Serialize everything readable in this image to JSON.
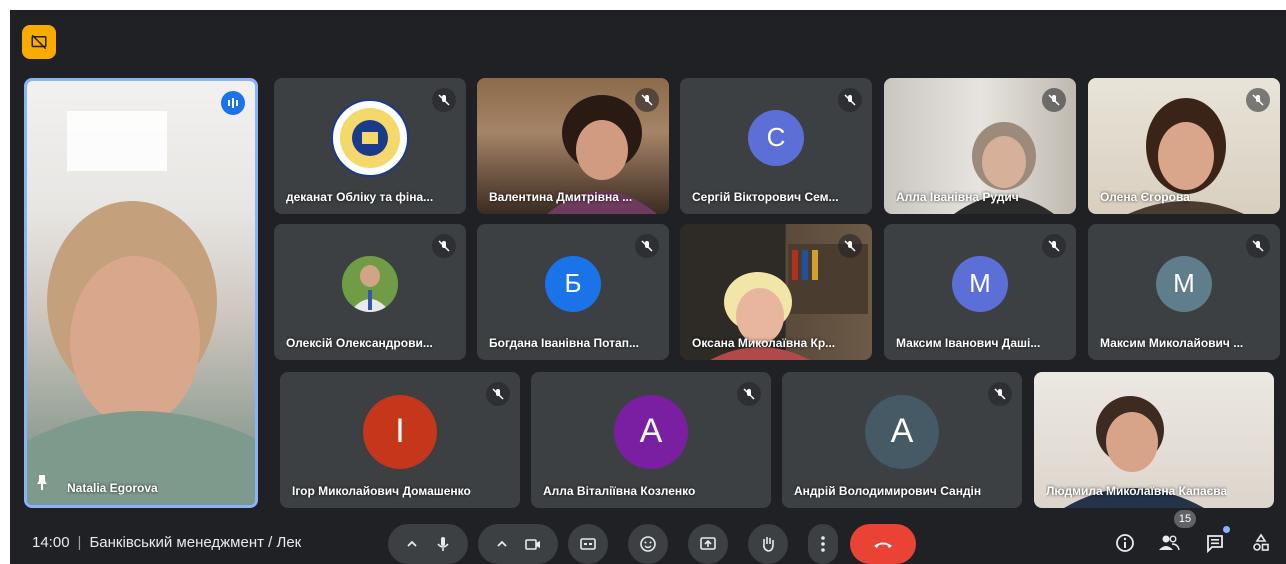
{
  "tiles_row1": [
    {
      "name": "деканат Обліку та фіна...",
      "avatar_type": "logo-seal",
      "video": "logo"
    },
    {
      "name": "Валентина Дмитрівна ...",
      "video": "camera-1"
    },
    {
      "name": "Сергій Вікторович Сем...",
      "initial": "С",
      "color": "#5b6fd6"
    },
    {
      "name": "Алла Іванівна Рудич",
      "video": "camera-2"
    },
    {
      "name": "Олена Єгорова",
      "video": "camera-3"
    }
  ],
  "tiles_row2": [
    {
      "name": "Олексій Олександрови...",
      "video": "photo"
    },
    {
      "name": "Богдана Іванівна Потап...",
      "initial": "Б",
      "color": "#1a73e8"
    },
    {
      "name": "Оксана Миколаївна Кр...",
      "video": "camera-4"
    },
    {
      "name": "Максим Іванович Даші...",
      "initial": "М",
      "color": "#5b6fd6"
    },
    {
      "name": "Максим Миколайович ...",
      "initial": "М",
      "color": "#607d8b"
    }
  ],
  "tiles_row3": [
    {
      "name": "Ігор Миколайович Домашенко",
      "initial": "І",
      "color": "#c5361b"
    },
    {
      "name": "Алла Віталіївна Козленко",
      "initial": "А",
      "color": "#7b1fa2"
    },
    {
      "name": "Андрій Володимирович Сандін",
      "initial": "А",
      "color": "#455a64"
    },
    {
      "name": "Людмила Миколаївна Капаєва",
      "video": "camera-5"
    }
  ],
  "featured": {
    "name": "Natalia Egorova"
  },
  "bottom": {
    "time": "14:00",
    "meeting": "Банківський менеджмент / Лек",
    "participants_count": "15"
  }
}
